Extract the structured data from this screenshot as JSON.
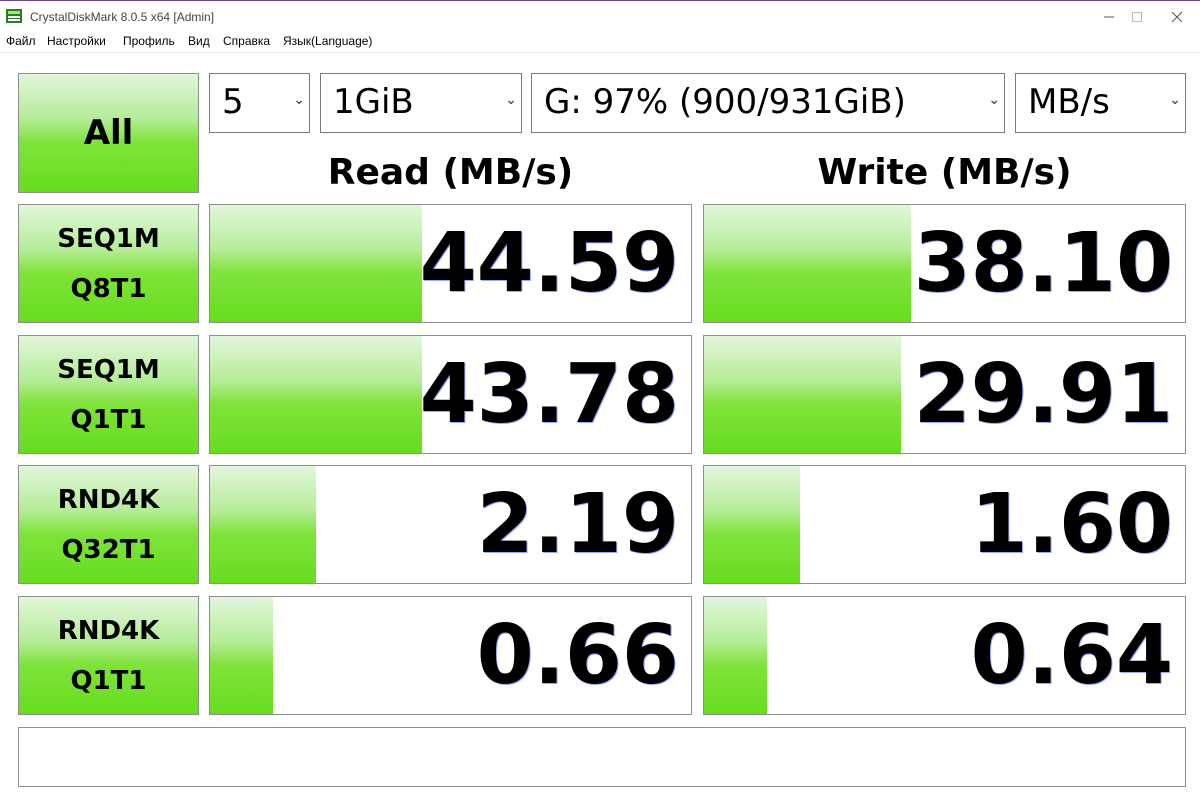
{
  "window": {
    "title": "CrystalDiskMark 8.0.5 x64 [Admin]",
    "controls": {
      "minimize": "—",
      "maximize": "☐",
      "close": "✕"
    }
  },
  "menu": [
    "Файл",
    "Настройки",
    "Профиль",
    "Вид",
    "Справка",
    "Язык(Language)"
  ],
  "controls": {
    "all_label": "All",
    "count": "5",
    "size": "1GiB",
    "drive": "G: 97% (900/931GiB)",
    "unit": "MB/s",
    "chevron": "⌄"
  },
  "headers": {
    "read": "Read (MB/s)",
    "write": "Write (MB/s)"
  },
  "tests": [
    {
      "line1": "SEQ1M",
      "line2": "Q8T1",
      "read": "44.59",
      "write": "38.10",
      "read_fill": 0.44,
      "write_fill": 0.43
    },
    {
      "line1": "SEQ1M",
      "line2": "Q1T1",
      "read": "43.78",
      "write": "29.91",
      "read_fill": 0.44,
      "write_fill": 0.41
    },
    {
      "line1": "RND4K",
      "line2": "Q32T1",
      "read": "2.19",
      "write": "1.60",
      "read_fill": 0.22,
      "write_fill": 0.2
    },
    {
      "line1": "RND4K",
      "line2": "Q1T1",
      "read": "0.66",
      "write": "0.64",
      "read_fill": 0.13,
      "write_fill": 0.13
    }
  ],
  "comment": ""
}
